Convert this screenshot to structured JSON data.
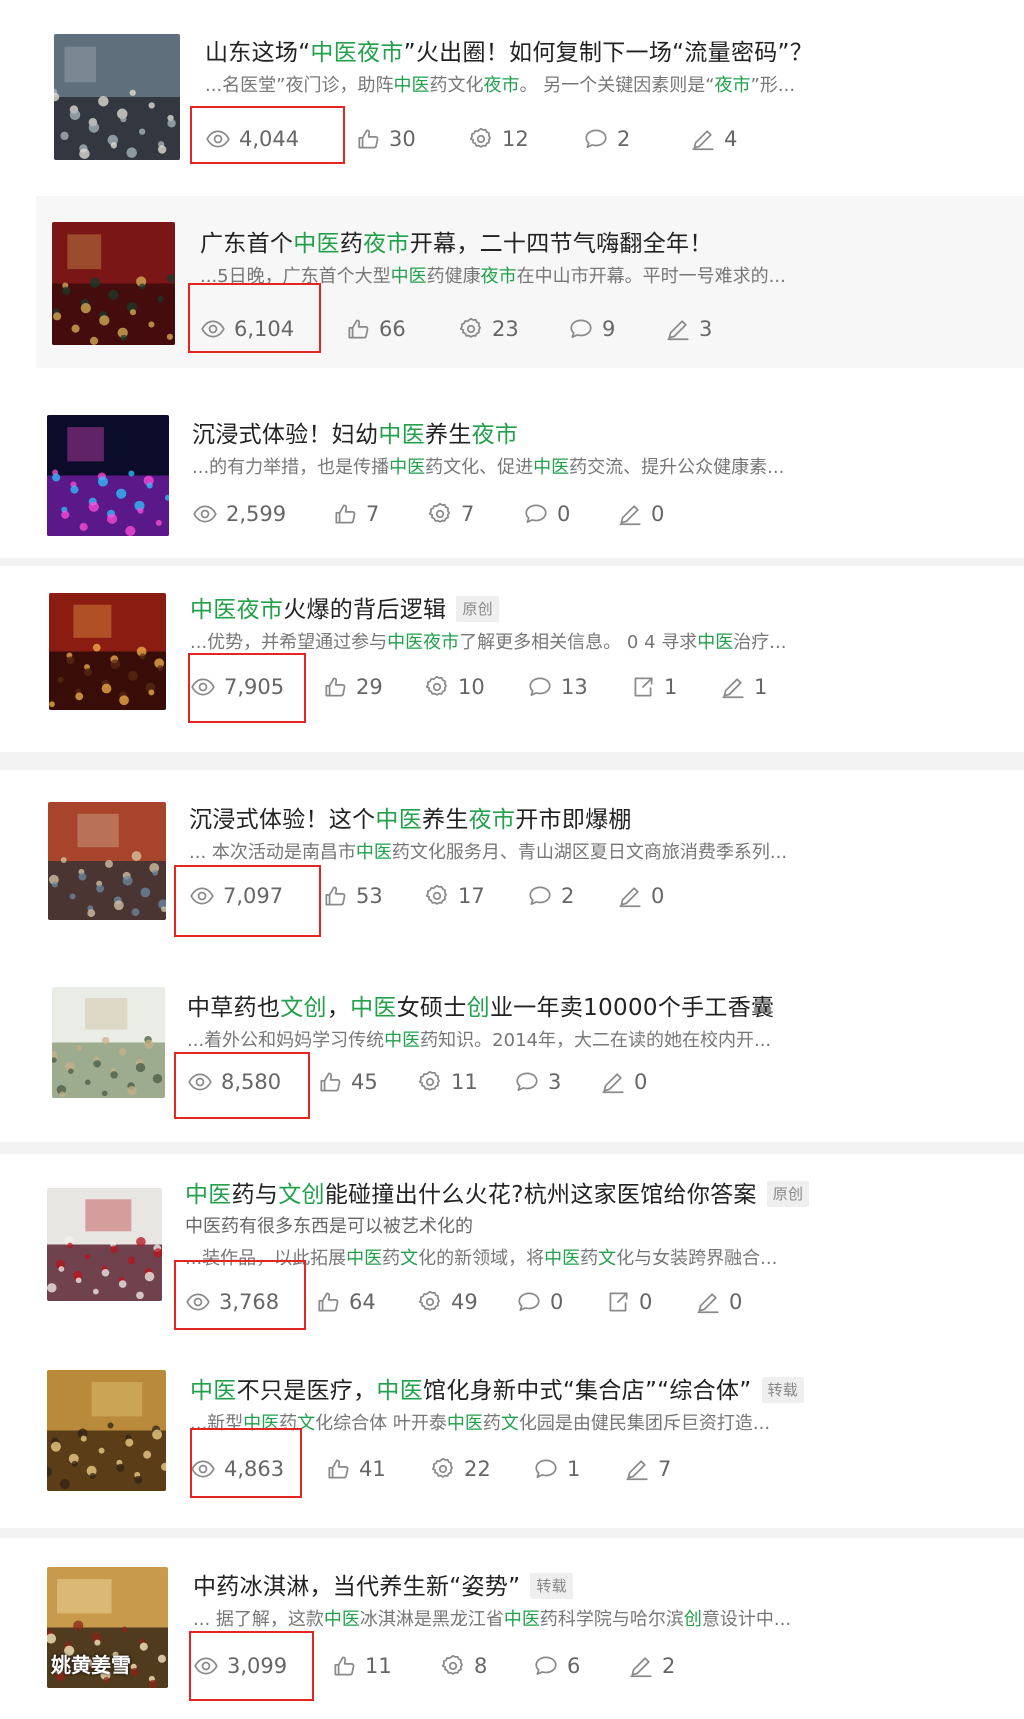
{
  "ui": {
    "highlight_color": "#22a04b",
    "annotation_color": "#e32622",
    "stat_icons": [
      "eye-icon",
      "thumbs-up-icon",
      "gear-icon",
      "comment-icon",
      "share-icon",
      "pencil-icon"
    ]
  },
  "articles": [
    {
      "title": [
        {
          "t": "山东这场“"
        },
        {
          "t": "中医夜市",
          "hl": true
        },
        {
          "t": "”火出圈！如何复制下一场“流量密码”？"
        }
      ],
      "excerpt": [
        {
          "t": "...名医堂”夜门诊，助阵"
        },
        {
          "t": "中医",
          "hl": true
        },
        {
          "t": "药文化"
        },
        {
          "t": "夜市",
          "hl": true
        },
        {
          "t": "。 另一个关键因素则是“"
        },
        {
          "t": "夜市",
          "hl": true
        },
        {
          "t": "”形..."
        }
      ],
      "stats": [
        {
          "icon": "eye-icon",
          "value": "4,044"
        },
        {
          "icon": "thumbs-up-icon",
          "value": "30"
        },
        {
          "icon": "gear-icon",
          "value": "12"
        },
        {
          "icon": "comment-icon",
          "value": "2"
        },
        {
          "icon": "pencil-icon",
          "value": "4"
        }
      ]
    },
    {
      "title": [
        {
          "t": "广东首个"
        },
        {
          "t": "中医",
          "hl": true
        },
        {
          "t": "药"
        },
        {
          "t": "夜市",
          "hl": true
        },
        {
          "t": "开幕，二十四节气嗨翻全年！"
        }
      ],
      "excerpt": [
        {
          "t": "...5日晚，广东首个大型"
        },
        {
          "t": "中医",
          "hl": true
        },
        {
          "t": "药健康"
        },
        {
          "t": "夜市",
          "hl": true
        },
        {
          "t": "在中山市开幕。平时一号难求的..."
        }
      ],
      "stats": [
        {
          "icon": "eye-icon",
          "value": "6,104"
        },
        {
          "icon": "thumbs-up-icon",
          "value": "66"
        },
        {
          "icon": "gear-icon",
          "value": "23"
        },
        {
          "icon": "comment-icon",
          "value": "9"
        },
        {
          "icon": "pencil-icon",
          "value": "3"
        }
      ]
    },
    {
      "title": [
        {
          "t": "沉浸式体验！妇幼"
        },
        {
          "t": "中医",
          "hl": true
        },
        {
          "t": "养生"
        },
        {
          "t": "夜市",
          "hl": true
        }
      ],
      "excerpt": [
        {
          "t": "...的有力举措，也是传播"
        },
        {
          "t": "中医",
          "hl": true
        },
        {
          "t": "药文化、促进"
        },
        {
          "t": "中医",
          "hl": true
        },
        {
          "t": "药交流、提升公众健康素..."
        }
      ],
      "stats": [
        {
          "icon": "eye-icon",
          "value": "2,599"
        },
        {
          "icon": "thumbs-up-icon",
          "value": "7"
        },
        {
          "icon": "gear-icon",
          "value": "7"
        },
        {
          "icon": "comment-icon",
          "value": "0"
        },
        {
          "icon": "pencil-icon",
          "value": "0"
        }
      ]
    },
    {
      "title": [
        {
          "t": "中医夜市",
          "hl": true
        },
        {
          "t": "火爆的背后逻辑"
        }
      ],
      "tag": "原创",
      "excerpt": [
        {
          "t": "...优势，并希望通过参与"
        },
        {
          "t": "中医夜市",
          "hl": true
        },
        {
          "t": "了解更多相关信息。 0 4 寻求"
        },
        {
          "t": "中医",
          "hl": true
        },
        {
          "t": "治疗..."
        }
      ],
      "stats": [
        {
          "icon": "eye-icon",
          "value": "7,905"
        },
        {
          "icon": "thumbs-up-icon",
          "value": "29"
        },
        {
          "icon": "gear-icon",
          "value": "10"
        },
        {
          "icon": "comment-icon",
          "value": "13"
        },
        {
          "icon": "share-icon",
          "value": "1"
        },
        {
          "icon": "pencil-icon",
          "value": "1"
        }
      ]
    },
    {
      "title": [
        {
          "t": "沉浸式体验！这个"
        },
        {
          "t": "中医",
          "hl": true
        },
        {
          "t": "养生"
        },
        {
          "t": "夜市",
          "hl": true
        },
        {
          "t": "开市即爆棚"
        }
      ],
      "excerpt": [
        {
          "t": "... 本次活动是南昌市"
        },
        {
          "t": "中医",
          "hl": true
        },
        {
          "t": "药文化服务月、青山湖区夏日文商旅消费季系列..."
        }
      ],
      "stats": [
        {
          "icon": "eye-icon",
          "value": "7,097"
        },
        {
          "icon": "thumbs-up-icon",
          "value": "53"
        },
        {
          "icon": "gear-icon",
          "value": "17"
        },
        {
          "icon": "comment-icon",
          "value": "2"
        },
        {
          "icon": "pencil-icon",
          "value": "0"
        }
      ]
    },
    {
      "title": [
        {
          "t": "中草药也"
        },
        {
          "t": "文创",
          "hl": true
        },
        {
          "t": "，"
        },
        {
          "t": "中医",
          "hl": true
        },
        {
          "t": "女硕士"
        },
        {
          "t": "创",
          "hl": true
        },
        {
          "t": "业一年卖10000个手工香囊"
        }
      ],
      "excerpt": [
        {
          "t": "...着外公和妈妈学习传统"
        },
        {
          "t": "中医",
          "hl": true
        },
        {
          "t": "药知识。2014年，大二在读的她在校内开..."
        }
      ],
      "stats": [
        {
          "icon": "eye-icon",
          "value": "8,580"
        },
        {
          "icon": "thumbs-up-icon",
          "value": "45"
        },
        {
          "icon": "gear-icon",
          "value": "11"
        },
        {
          "icon": "comment-icon",
          "value": "3"
        },
        {
          "icon": "pencil-icon",
          "value": "0"
        }
      ]
    },
    {
      "title": [
        {
          "t": "中医",
          "hl": true
        },
        {
          "t": "药与"
        },
        {
          "t": "文创",
          "hl": true
        },
        {
          "t": "能碰撞出什么火花?杭州这家医馆给你答案"
        }
      ],
      "tag": "原创",
      "subline": "中医药有很多东西是可以被艺术化的",
      "excerpt": [
        {
          "t": "...装作品，以此拓展"
        },
        {
          "t": "中医",
          "hl": true
        },
        {
          "t": "药"
        },
        {
          "t": "文",
          "hl": true
        },
        {
          "t": "化的新领域，将"
        },
        {
          "t": "中医",
          "hl": true
        },
        {
          "t": "药"
        },
        {
          "t": "文",
          "hl": true
        },
        {
          "t": "化与女装跨界融合..."
        }
      ],
      "stats": [
        {
          "icon": "eye-icon",
          "value": "3,768"
        },
        {
          "icon": "thumbs-up-icon",
          "value": "64"
        },
        {
          "icon": "gear-icon",
          "value": "49"
        },
        {
          "icon": "comment-icon",
          "value": "0"
        },
        {
          "icon": "share-icon",
          "value": "0"
        },
        {
          "icon": "pencil-icon",
          "value": "0"
        }
      ]
    },
    {
      "title": [
        {
          "t": "中医",
          "hl": true
        },
        {
          "t": "不只是医疗，"
        },
        {
          "t": "中医",
          "hl": true
        },
        {
          "t": "馆化身新中式“集合店”“综合体”"
        }
      ],
      "tag": "转载",
      "excerpt": [
        {
          "t": "...新型"
        },
        {
          "t": "中医",
          "hl": true
        },
        {
          "t": "药"
        },
        {
          "t": "文",
          "hl": true
        },
        {
          "t": "化综合体 叶开泰"
        },
        {
          "t": "中医",
          "hl": true
        },
        {
          "t": "药"
        },
        {
          "t": "文",
          "hl": true
        },
        {
          "t": "化园是由健民集团斥巨资打造..."
        }
      ],
      "stats": [
        {
          "icon": "eye-icon",
          "value": "4,863"
        },
        {
          "icon": "thumbs-up-icon",
          "value": "41"
        },
        {
          "icon": "gear-icon",
          "value": "22"
        },
        {
          "icon": "comment-icon",
          "value": "1"
        },
        {
          "icon": "pencil-icon",
          "value": "7"
        }
      ]
    },
    {
      "title": [
        {
          "t": "中药冰淇淋，当代养生新“姿势”"
        }
      ],
      "tag": "转载",
      "thumb_text": "姚黄姜雪",
      "excerpt": [
        {
          "t": "... 据了解，这款"
        },
        {
          "t": "中医",
          "hl": true
        },
        {
          "t": "冰淇淋是黑龙江省"
        },
        {
          "t": "中医",
          "hl": true
        },
        {
          "t": "药科学院与哈尔滨"
        },
        {
          "t": "创",
          "hl": true
        },
        {
          "t": "意设计中..."
        }
      ],
      "stats": [
        {
          "icon": "eye-icon",
          "value": "3,099"
        },
        {
          "icon": "thumbs-up-icon",
          "value": "11"
        },
        {
          "icon": "gear-icon",
          "value": "8"
        },
        {
          "icon": "comment-icon",
          "value": "6"
        },
        {
          "icon": "pencil-icon",
          "value": "2"
        }
      ]
    }
  ]
}
